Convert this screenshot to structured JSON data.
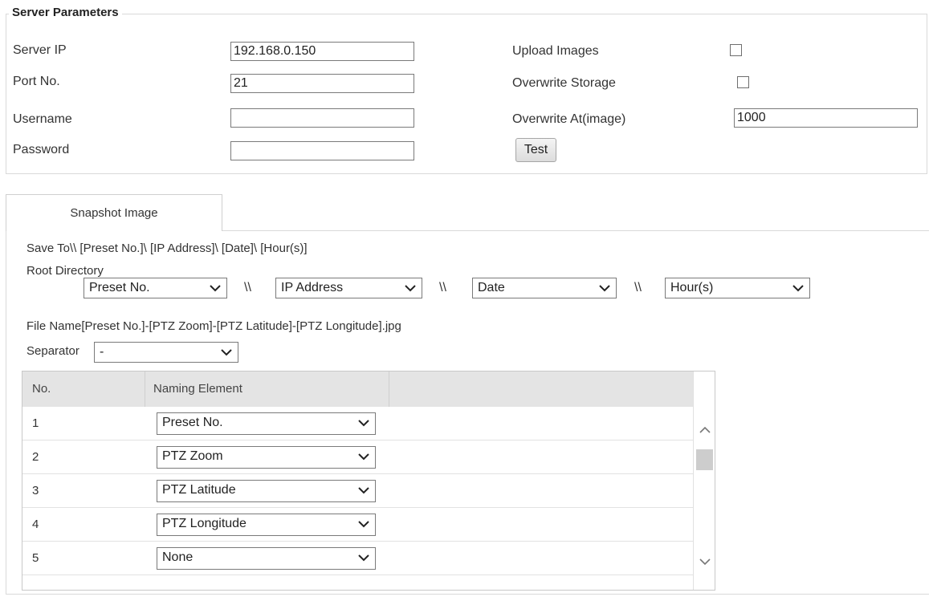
{
  "server": {
    "legend": "Server Parameters",
    "server_ip_label": "Server IP",
    "server_ip_value": "192.168.0.150",
    "port_label": "Port No.",
    "port_value": "21",
    "username_label": "Username",
    "username_value": "",
    "password_label": "Password",
    "password_value": "",
    "upload_images_label": "Upload Images",
    "overwrite_storage_label": "Overwrite Storage",
    "overwrite_at_label": "Overwrite At(image)",
    "overwrite_at_value": "1000",
    "test_label": "Test"
  },
  "tab": {
    "label": "Snapshot Image"
  },
  "save": {
    "path_text": "Save To\\\\ [Preset No.]\\ [IP Address]\\ [Date]\\ [Hour(s)]",
    "root_label": "Root Directory",
    "dir1": "Preset No.",
    "dir2": "IP Address",
    "dir3": "Date",
    "dir4": "Hour(s)",
    "sep_glyph": "\\\\"
  },
  "file": {
    "name_text": "File Name[Preset No.]-[PTZ Zoom]-[PTZ Latitude]-[PTZ Longitude].jpg",
    "separator_label": "Separator",
    "separator_value": "-"
  },
  "table": {
    "col_no": "No.",
    "col_element": "Naming Element",
    "rows": [
      {
        "no": "1",
        "element": "Preset No."
      },
      {
        "no": "2",
        "element": "PTZ Zoom"
      },
      {
        "no": "3",
        "element": "PTZ Latitude"
      },
      {
        "no": "4",
        "element": "PTZ Longitude"
      },
      {
        "no": "5",
        "element": "None"
      }
    ]
  },
  "colors": {
    "border": "#d9d9d9",
    "header_bg": "#e4e4e4"
  },
  "icons": {
    "dropdown": "chevron-down-icon",
    "scroll_up": "chevron-up-icon",
    "scroll_down": "chevron-down-icon"
  }
}
